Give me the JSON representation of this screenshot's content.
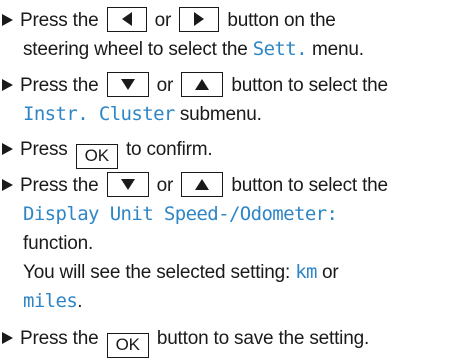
{
  "steps": [
    {
      "t1": "Press the",
      "t2": "or",
      "t3": "button on the",
      "t4": "steering wheel to select the",
      "menu": "Sett.",
      "t5": "menu."
    },
    {
      "t1": "Press the",
      "t2": "or",
      "t3": "button to select the",
      "submenu": "Instr. Cluster",
      "t4": "submenu."
    },
    {
      "t1": "Press",
      "key": "OK",
      "t2": "to confirm."
    },
    {
      "t1": "Press the",
      "t2": "or",
      "t3": "button to select the",
      "function": "Display Unit Speed-/Odometer:",
      "t4": "function.",
      "t5": "You will see the selected setting:",
      "opt1": "km",
      "t6": "or",
      "opt2": "miles",
      "t7": "."
    },
    {
      "t1": "Press the",
      "key": "OK",
      "t2": "button to save the setting."
    }
  ],
  "colors": {
    "accent": "#2f86c6",
    "text": "#1a1a1a"
  }
}
